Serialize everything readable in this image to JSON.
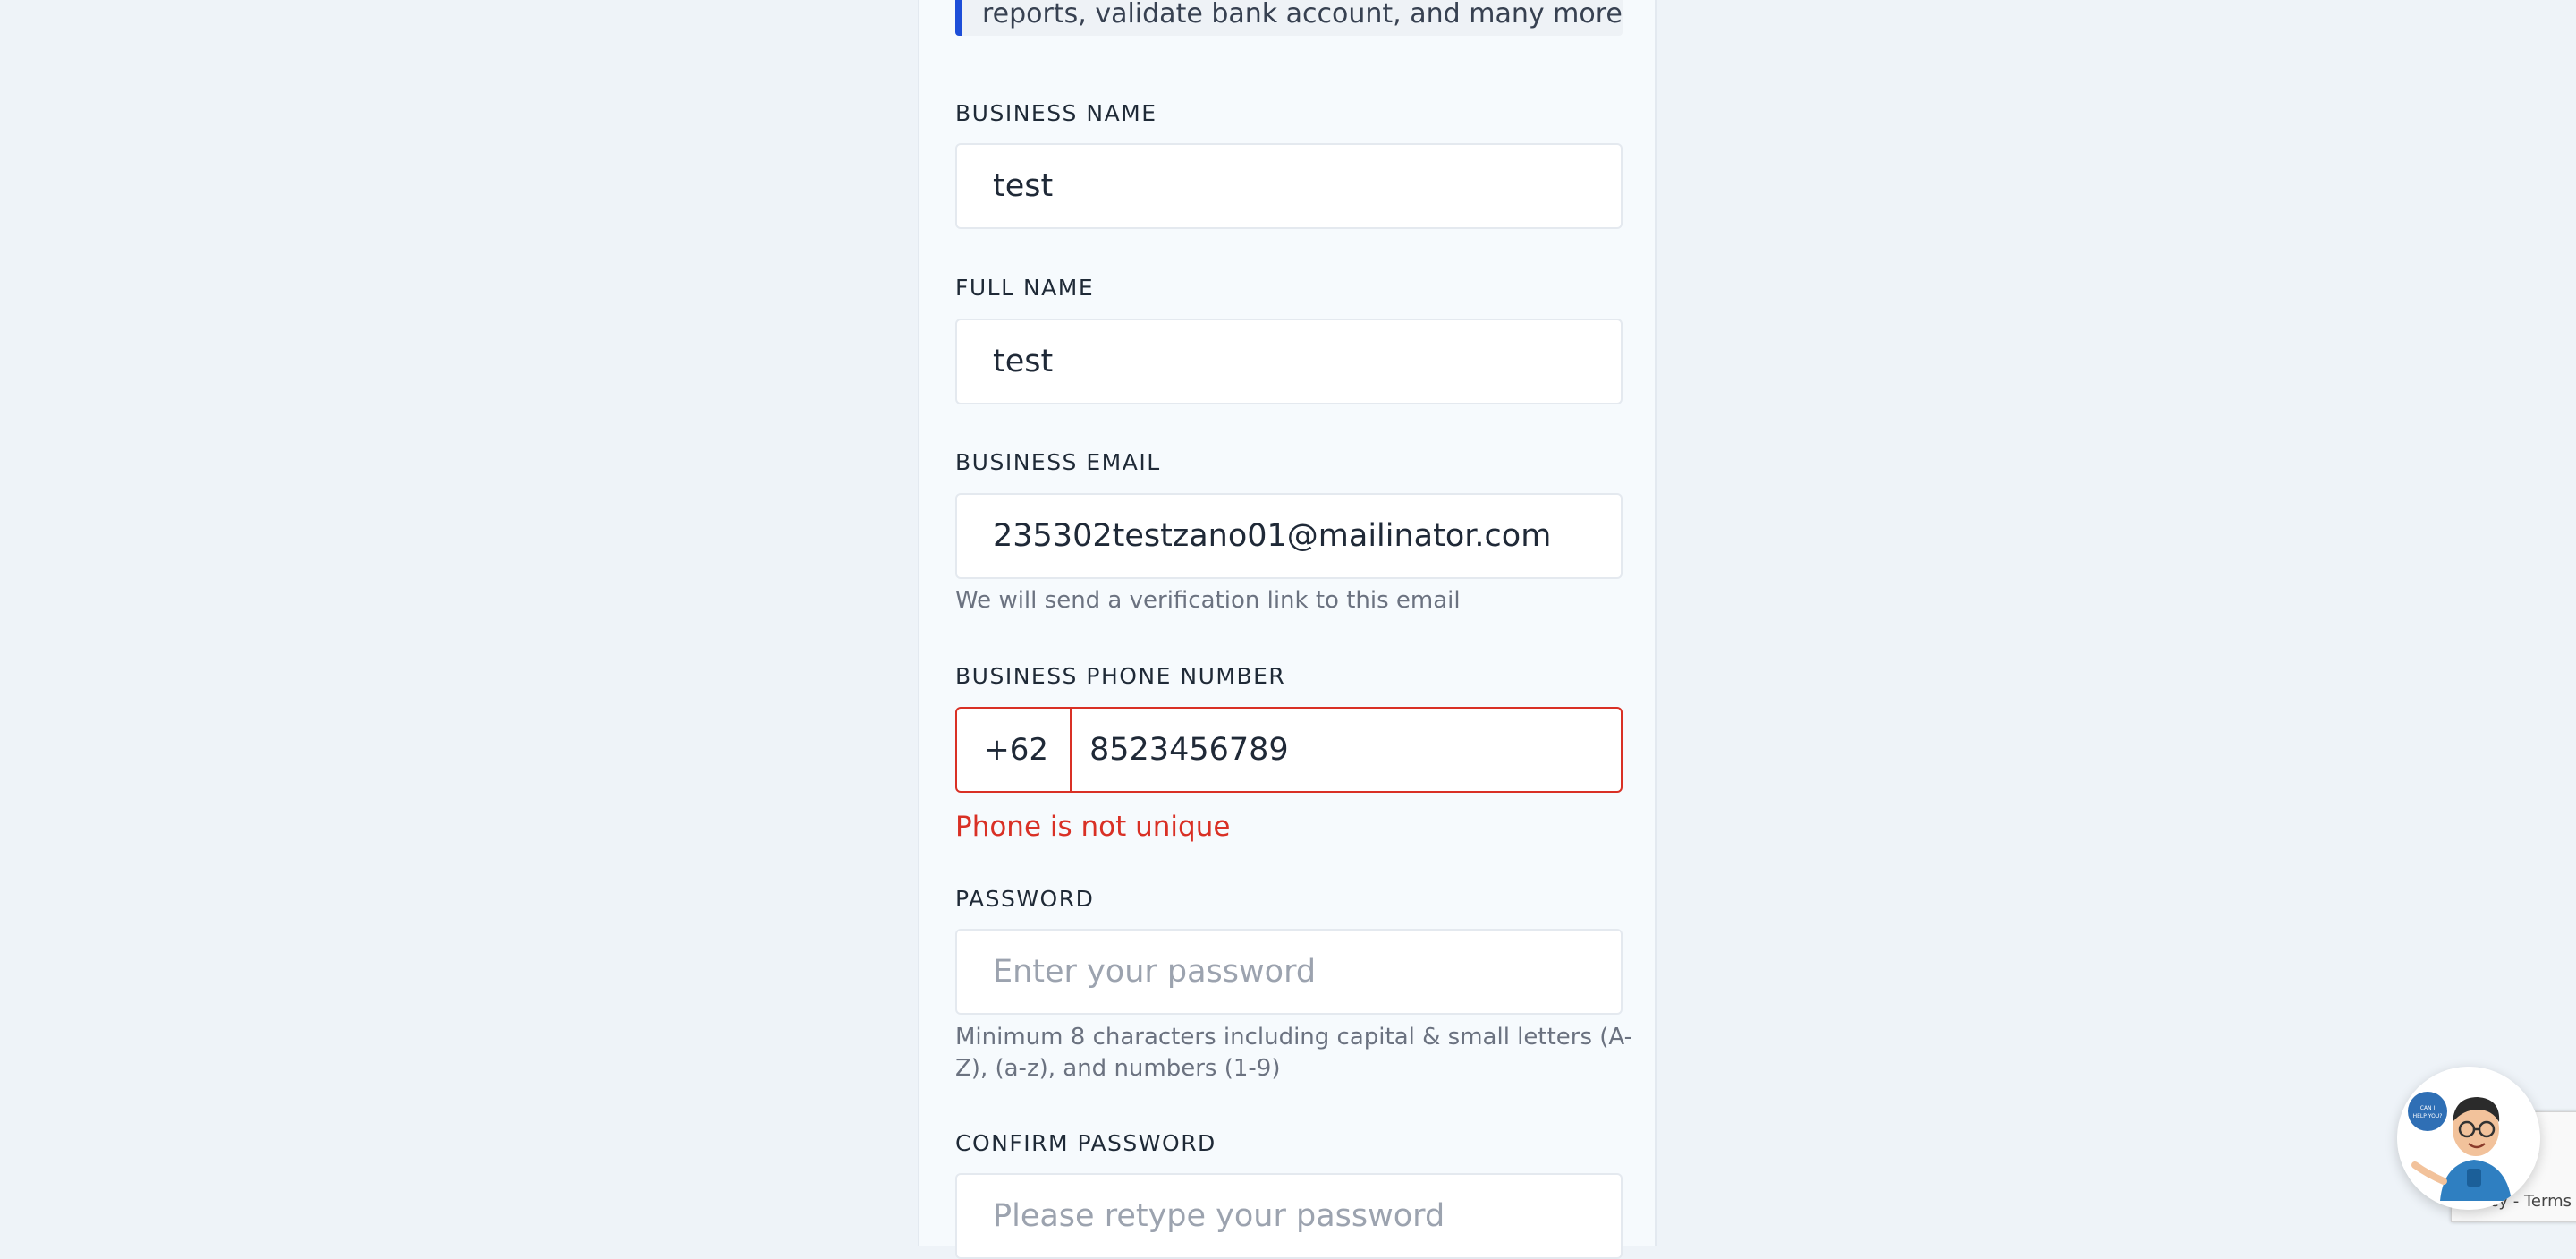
{
  "notice": {
    "text": "reports, validate bank account, and many more."
  },
  "form": {
    "business_name": {
      "label": "BUSINESS NAME",
      "value": "test"
    },
    "full_name": {
      "label": "FULL NAME",
      "value": "test"
    },
    "business_email": {
      "label": "BUSINESS EMAIL",
      "value": "235302testzano01@mailinator.com",
      "hint": "We will send a verification link to this email"
    },
    "phone": {
      "label": "BUSINESS PHONE NUMBER",
      "country_code": "+62",
      "value": "8523456789",
      "error": "Phone is not unique"
    },
    "password": {
      "label": "PASSWORD",
      "placeholder": "Enter your password",
      "hint": "Minimum 8 characters including capital & small letters (A-Z), (a-z), and numbers (1-9)"
    },
    "confirm_password": {
      "label": "CONFIRM PASSWORD",
      "placeholder": "Please retype your password"
    }
  },
  "chat_widget": {
    "bubble_text": "CAN I HELP YOU?",
    "icon": "mascot-avatar-icon"
  },
  "recaptcha": {
    "text": "Privacy - Terms"
  },
  "colors": {
    "accent": "#1d4ed8",
    "error": "#d93025",
    "page_bg": "#eef3f8",
    "card_bg": "#f6fafd"
  }
}
